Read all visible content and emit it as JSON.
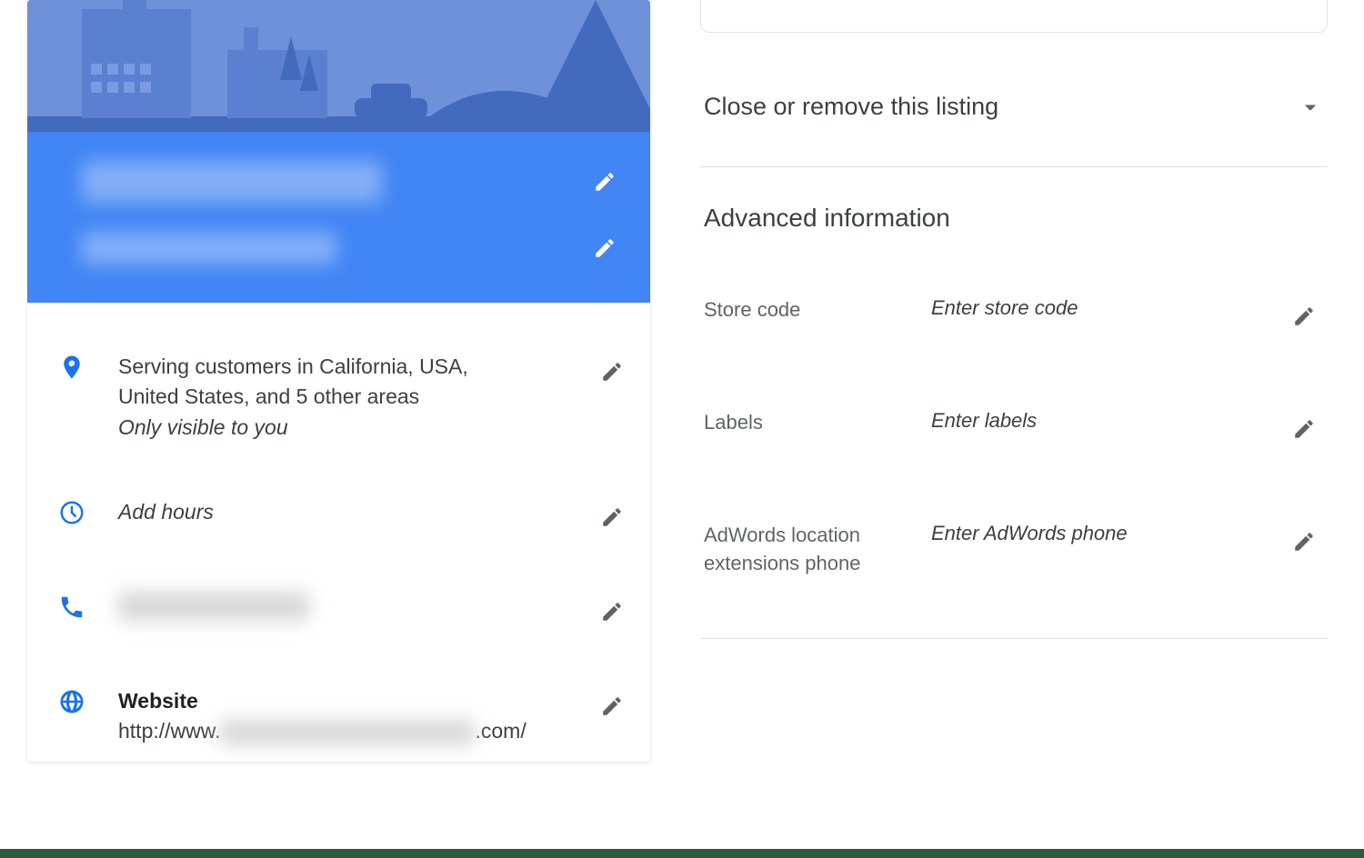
{
  "left": {
    "location": {
      "line1": "Serving customers in California, USA,",
      "line2": "United States, and 5 other areas",
      "visibility": "Only visible to you"
    },
    "hours_hint": "Add hours",
    "website": {
      "label": "Website",
      "prefix": "http://www.",
      "suffix": ".com/"
    }
  },
  "right": {
    "close_label": "Close or remove this listing",
    "advanced_heading": "Advanced information",
    "store_code": {
      "label": "Store code",
      "hint": "Enter store code"
    },
    "labels": {
      "label": "Labels",
      "hint": "Enter labels"
    },
    "adwords": {
      "label": "AdWords location extensions phone",
      "hint": "Enter AdWords phone"
    }
  },
  "colors": {
    "accent": "#4285f4"
  }
}
